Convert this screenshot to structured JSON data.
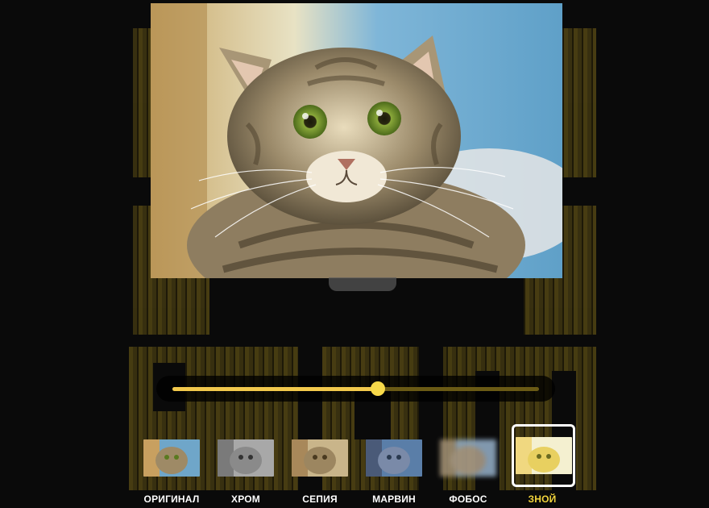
{
  "editor": {
    "intensity": 0.56
  },
  "filters": [
    {
      "id": "original",
      "label": "ОРИГИНАЛ",
      "selected": false,
      "tone": "#a98f6c"
    },
    {
      "id": "chrome",
      "label": "ХРОМ",
      "selected": false,
      "tone": "#9a9a9a"
    },
    {
      "id": "sepia",
      "label": "СЕПИЯ",
      "selected": false,
      "tone": "#b09b78"
    },
    {
      "id": "marvin",
      "label": "МАРВИН",
      "selected": false,
      "tone": "#7d8fa8"
    },
    {
      "id": "phobos",
      "label": "ФОБОС",
      "selected": false,
      "tone": "#8fa0b5"
    },
    {
      "id": "heat",
      "label": "ЗНОЙ",
      "selected": true,
      "tone": "#e8d870"
    }
  ],
  "colors": {
    "accent": "#f2d43b",
    "background": "#0a0a0a"
  }
}
